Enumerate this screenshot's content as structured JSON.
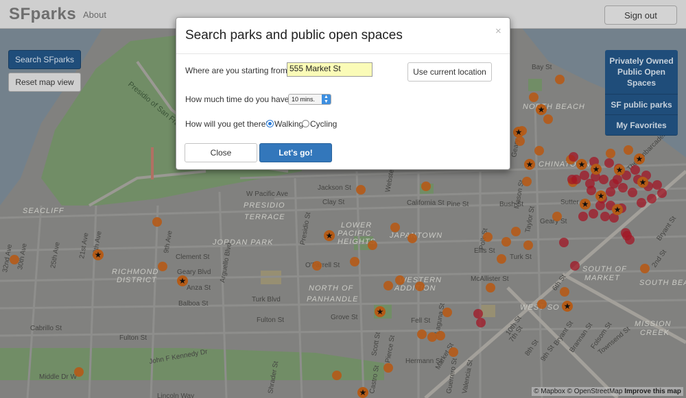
{
  "navbar": {
    "brand": "SFparks",
    "about": "About",
    "sign_out": "Sign out"
  },
  "left_buttons": {
    "search": "Search SFparks",
    "reset": "Reset map view"
  },
  "right_panel": {
    "items": [
      "Privately Owned Public Open Spaces",
      "SF public parks",
      "My Favorites"
    ]
  },
  "attribution": {
    "mapbox": "© Mapbox",
    "osm": "© OpenStreetMap",
    "improve": "Improve this map"
  },
  "modal": {
    "title": "Search parks and public open spaces",
    "close_symbol": "×",
    "start_label": "Where are you starting from?",
    "start_value": "555 Market St",
    "use_location": "Use current location",
    "time_label": "How much time do you have?",
    "time_value": "10 mins.",
    "mode_label": "How will you get there?",
    "mode_options": [
      "Walking",
      "Cycling"
    ],
    "mode_selected": "Walking",
    "close_button": "Close",
    "go_button": "Let's go!"
  },
  "map": {
    "labels": [
      {
        "text": "Presidio of San Francisco"
      },
      {
        "text": "PRESIDIO"
      },
      {
        "text": "TERRACE"
      },
      {
        "text": "SEACLIFF"
      },
      {
        "text": "JORDAN PARK"
      },
      {
        "text": "RICHMOND"
      },
      {
        "text": "DISTRICT"
      },
      {
        "text": "LOWER"
      },
      {
        "text": "PACIFIC"
      },
      {
        "text": "HEIGHTS"
      },
      {
        "text": "JAPANTOWN"
      },
      {
        "text": "NORTH BEACH"
      },
      {
        "text": "CHINATOWN"
      },
      {
        "text": "WESTERN"
      },
      {
        "text": "ADDITION"
      },
      {
        "text": "NORTH OF"
      },
      {
        "text": "PANHANDLE"
      },
      {
        "text": "SOUTH OF"
      },
      {
        "text": "MARKET"
      },
      {
        "text": "SOUTH BEACH"
      },
      {
        "text": "MISSION"
      },
      {
        "text": "CREEK"
      },
      {
        "text": "WEST SO"
      },
      {
        "text": "Bay St"
      },
      {
        "text": "Jackson St"
      },
      {
        "text": "Clay St"
      },
      {
        "text": "California St"
      },
      {
        "text": "Pine St"
      },
      {
        "text": "Bush St"
      },
      {
        "text": "Sutter St"
      },
      {
        "text": "Geary St"
      },
      {
        "text": "Geary Blvd"
      },
      {
        "text": "Anza St"
      },
      {
        "text": "Balboa St"
      },
      {
        "text": "Cabrillo St"
      },
      {
        "text": "Fulton St"
      },
      {
        "text": "John F Kennedy Dr"
      },
      {
        "text": "Middle Dr W"
      },
      {
        "text": "Lincoln Way"
      },
      {
        "text": "Clement St"
      },
      {
        "text": "Turk Blvd"
      },
      {
        "text": "Fulton St"
      },
      {
        "text": "Grove St"
      },
      {
        "text": "Fell St"
      },
      {
        "text": "Turk St"
      },
      {
        "text": "Ellis St"
      },
      {
        "text": "O'Farrell St"
      },
      {
        "text": "McAllister St"
      },
      {
        "text": "Hermann St"
      },
      {
        "text": "Market St"
      },
      {
        "text": "Folsom St"
      },
      {
        "text": "Bryant St"
      },
      {
        "text": "Brannan St"
      },
      {
        "text": "Townsend St"
      },
      {
        "text": "2nd St"
      },
      {
        "text": "6th St"
      },
      {
        "text": "7th St"
      },
      {
        "text": "8th St"
      },
      {
        "text": "9th St"
      },
      {
        "text": "10th St"
      },
      {
        "text": "The Embarcadero"
      },
      {
        "text": "Bryant St"
      },
      {
        "text": "Taylor St"
      },
      {
        "text": "Mason St"
      },
      {
        "text": "Polk St"
      },
      {
        "text": "Webster St"
      },
      {
        "text": "Presidio St"
      },
      {
        "text": "Arguello Blvd"
      },
      {
        "text": "25th Ave"
      },
      {
        "text": "21st Ave"
      },
      {
        "text": "19th Ave"
      },
      {
        "text": "9th Ave"
      },
      {
        "text": "30th Ave"
      },
      {
        "text": "32nd Ave"
      },
      {
        "text": "W Pacific Ave"
      },
      {
        "text": "Valencia St"
      },
      {
        "text": "Guerrero St"
      },
      {
        "text": "Castro St"
      },
      {
        "text": "Scott St"
      },
      {
        "text": "Pierce St"
      },
      {
        "text": "Shrader St"
      },
      {
        "text": "Laguna St"
      },
      {
        "text": "Geary St"
      }
    ]
  }
}
